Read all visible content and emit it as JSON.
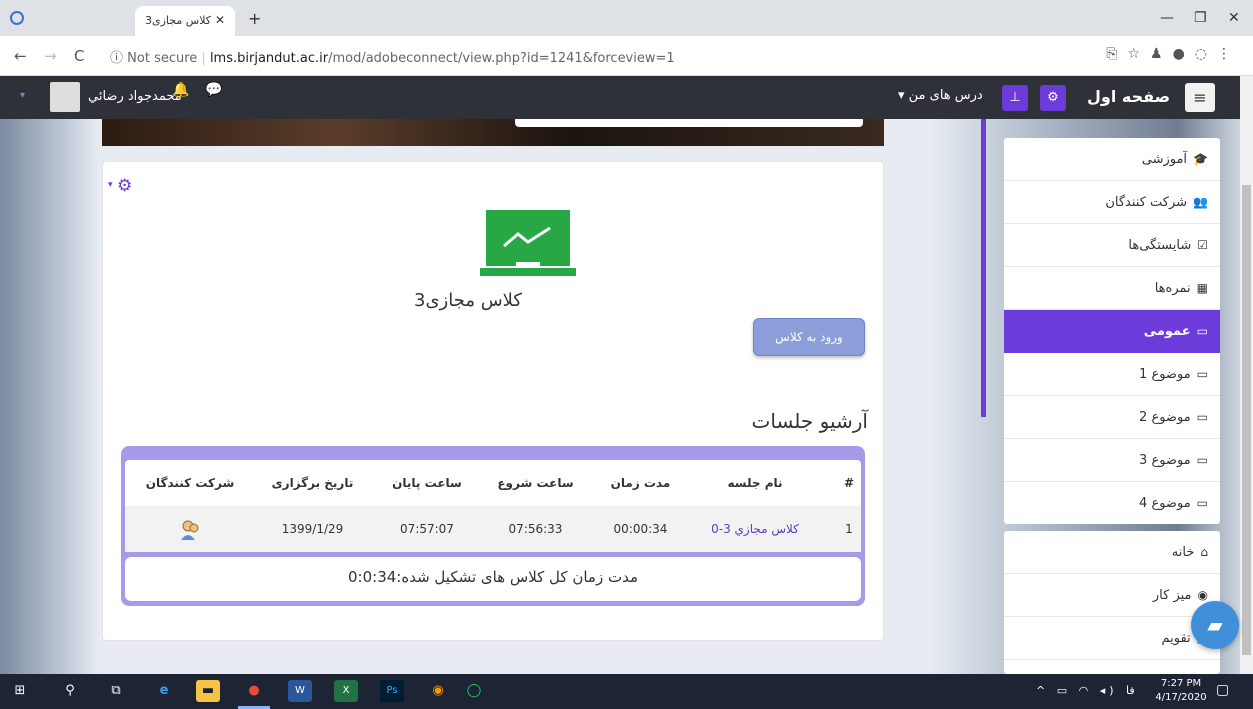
{
  "browser": {
    "tab_title": "کلاس مجازی3",
    "tab_close": "✕",
    "new_tab": "+",
    "url_security": "Not secure",
    "url_host": "lms.birjandut.ac.ir",
    "url_path": "/mod/adobeconnect/view.php?id=1241&forceview=1",
    "back": "←",
    "forward": "→",
    "reload": "C",
    "info": "ⓘ",
    "minimize": "—",
    "maximize": "❐",
    "close": "✕"
  },
  "navbar": {
    "menu_icon": "≡",
    "site_name": "صفحه اول",
    "my_courses": "درس های من ▾",
    "user_name": "محمدجواد رضائي",
    "user_caret": "▾"
  },
  "activity": {
    "title": "کلاس مجازی3",
    "enter_button": "ورود به کلاس",
    "archive_title": "آرشیو جلسات",
    "summary": "مدت زمان کل کلاس های تشکیل شده:0:0:34"
  },
  "table": {
    "headers": {
      "num": "#",
      "session_name": "نام جلسه",
      "duration": "مدت زمان",
      "start_time": "ساعت شروع",
      "end_time": "ساعت پایان",
      "date": "تاریخ برگزاری",
      "participants": "شرکت کنندگان"
    },
    "rows": [
      {
        "num": "1",
        "session_name": "کلاس مجازي 3-0",
        "duration": "00:00:34",
        "start_time": "07:56:33",
        "end_time": "07:57:07",
        "date": "1399/1/29"
      }
    ]
  },
  "sidebar": {
    "items": [
      {
        "label": "آموزشی",
        "icon": "🎓"
      },
      {
        "label": "شرکت کنندگان",
        "icon": "👥"
      },
      {
        "label": "شایستگی‌ها",
        "icon": "☑"
      },
      {
        "label": "نمره‌ها",
        "icon": "▦"
      },
      {
        "label": "عمومی",
        "icon": "▭"
      },
      {
        "label": "موضوع 1",
        "icon": "▭"
      },
      {
        "label": "موضوع 2",
        "icon": "▭"
      },
      {
        "label": "موضوع 3",
        "icon": "▭"
      },
      {
        "label": "موضوع 4",
        "icon": "▭"
      }
    ],
    "items2": [
      {
        "label": "خانه",
        "icon": "⌂"
      },
      {
        "label": "میز کار",
        "icon": "◉"
      },
      {
        "label": "تقویم",
        "icon": "▦"
      }
    ]
  },
  "taskbar": {
    "time": "7:27 PM",
    "date": "4/17/2020",
    "lang": "فا"
  },
  "colors": {
    "accent": "#6c3bd9",
    "navbar": "#2e3238",
    "button": "#8b9ed9",
    "table_border": "#a59be8"
  }
}
